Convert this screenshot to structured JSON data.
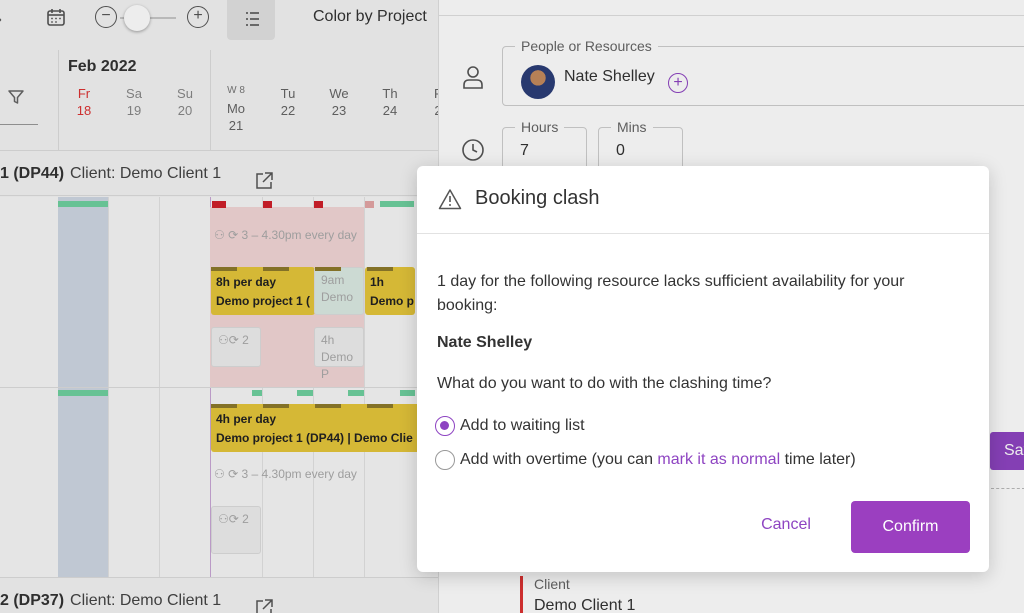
{
  "toolbar": {
    "color_by_label": "Color by Project"
  },
  "schedule": {
    "month": "Feb 2022",
    "week_label": "W 8",
    "days": [
      {
        "name": "Fr",
        "num": "18"
      },
      {
        "name": "Sa",
        "num": "19"
      },
      {
        "name": "Su",
        "num": "20"
      },
      {
        "name": "Mo",
        "num": "21"
      },
      {
        "name": "Tu",
        "num": "22"
      },
      {
        "name": "We",
        "num": "23"
      },
      {
        "name": "Th",
        "num": "24"
      },
      {
        "name": "F",
        "num": "2"
      }
    ],
    "project1": {
      "title": "1 (DP44)",
      "client": "Client: Demo Client 1"
    },
    "project2": {
      "title": "2 (DP37)",
      "client": "Client: Demo Client 1"
    },
    "events": {
      "recurring_1": "3 – 4.30pm every day",
      "recurring_2": "3 – 4.30pm every day",
      "booking_8h_line1": "8h per day",
      "booking_8h_line2": "Demo project 1 (",
      "ghost_9am_line1": "9am",
      "ghost_9am_line2": "Demo",
      "booking_1h_line1": "1h",
      "booking_1h_line2": "Demo p",
      "ghost_4h_line1": "4h",
      "ghost_4h_line2": "Demo P",
      "ghost_2a": "2",
      "ghost_2b": "2",
      "booking_4h_line1": "4h per day",
      "booking_4h_line2": "Demo project 1 (DP44) | Demo Clie"
    }
  },
  "panel": {
    "people_label": "People or Resources",
    "person_name": "Nate Shelley",
    "hours_label": "Hours",
    "hours_value": "7",
    "mins_label": "Mins",
    "mins_value": "0",
    "save_label": "Sav",
    "client_label": "Client",
    "client_value": "Demo Client 1"
  },
  "modal": {
    "title": "Booking clash",
    "message": "1 day for the following resource lacks sufficient availability for your booking:",
    "resource_name": "Nate Shelley",
    "question": "What do you want to do with the clashing time?",
    "option_waiting": "Add to waiting list",
    "option_overtime_prefix": "Add with overtime (you can ",
    "option_overtime_link": "mark it as normal",
    "option_overtime_suffix": " time later)",
    "selected_option": "waiting",
    "cancel_label": "Cancel",
    "confirm_label": "Confirm"
  },
  "colors": {
    "accent": "#9b3fc0",
    "booking_yellow": "#e6c63b",
    "clash_red": "#d0202a",
    "available_green": "#6fd1a0"
  }
}
